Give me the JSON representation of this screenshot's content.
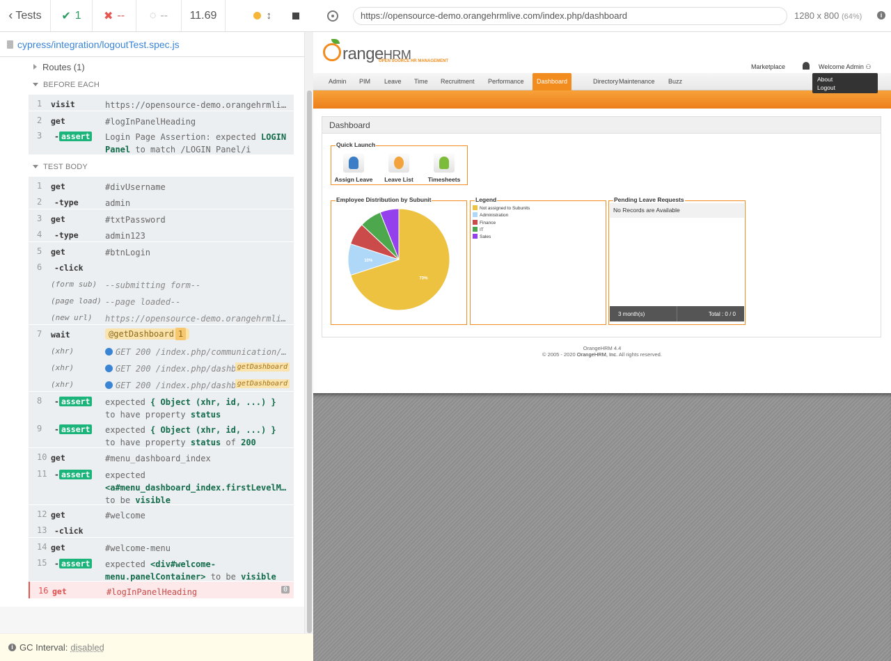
{
  "reporter": {
    "tests_label": "Tests",
    "passed": "1",
    "failed": "--",
    "pending": "--",
    "duration": "11.69",
    "spec_path": "cypress/integration/logoutTest.spec.js",
    "routes_label": "Routes (1)",
    "before_each_label": "BEFORE EACH",
    "test_body_label": "TEST BODY",
    "before_each": [
      {
        "num": "1",
        "name": "visit",
        "msg": "https://opensource-demo.orangehrmlive.com/"
      },
      {
        "num": "2",
        "name": "get",
        "msg": "#logInPanelHeading"
      },
      {
        "num": "3",
        "name": "assert",
        "msg_parts": [
          "Login Page Assertion: expected",
          "LOGIN Panel",
          "to match",
          "/LOGIN Panel/i"
        ]
      }
    ],
    "body": [
      {
        "num": "1",
        "name": "get",
        "msg": "#divUsername"
      },
      {
        "num": "2",
        "name": "-type",
        "msg": "admin"
      },
      {
        "num": "3",
        "name": "get",
        "msg": "#txtPassword"
      },
      {
        "num": "4",
        "name": "-type",
        "msg": "admin123"
      },
      {
        "num": "5",
        "name": "get",
        "msg": "#btnLogin"
      },
      {
        "num": "6",
        "name": "-click",
        "msg": ""
      },
      {
        "num": "",
        "name": "(form sub)",
        "msg": "--submitting form--"
      },
      {
        "num": "",
        "name": "(page load)",
        "msg": "--page loaded--"
      },
      {
        "num": "",
        "name": "(new url)",
        "msg": "https://opensource-demo.orangehrmlive.com/index.php/dashboard"
      },
      {
        "num": "7",
        "name": "wait",
        "alias": "@getDashboard",
        "alias_count": "1"
      },
      {
        "num": "",
        "name": "(xhr)",
        "msg": "GET 200 /index.php/communication/..."
      },
      {
        "num": "",
        "name": "(xhr)",
        "msg": "GET 200 /index.php/dashboard/...",
        "alias": "getDashboard"
      },
      {
        "num": "",
        "name": "(xhr)",
        "msg": "GET 200 /index.php/dashboard/...",
        "alias": "getDashboard"
      },
      {
        "num": "8",
        "name": "assert",
        "l1a": "expected",
        "l1b": "{ Object (xhr, id, ...) }",
        "l2a": "to have property",
        "l2b": "status"
      },
      {
        "num": "9",
        "name": "assert",
        "l1a": "expected",
        "l1b": "{ Object (xhr, id, ...) }",
        "l2a": "to have property",
        "l2b": "status",
        "l2c": "of",
        "l2d": "200"
      },
      {
        "num": "10",
        "name": "get",
        "msg": "#menu_dashboard_index"
      },
      {
        "num": "11",
        "name": "assert",
        "l1a": "expected",
        "l2b": "<a#menu_dashboard_index.firstLevelMenu>",
        "l3a": "to be",
        "l3b": "visible"
      },
      {
        "num": "12",
        "name": "get",
        "msg": "#welcome"
      },
      {
        "num": "13",
        "name": "-click",
        "msg": ""
      },
      {
        "num": "14",
        "name": "get",
        "msg": "#welcome-menu"
      },
      {
        "num": "15",
        "name": "assert",
        "l1a": "expected",
        "l1b": "<div#welcome-",
        "l2b": "menu.panelContainer>",
        "l2c": "to be",
        "l2d": "visible"
      },
      {
        "num": "16",
        "name": "get",
        "msg": "#logInPanelHeading",
        "retries": "0"
      }
    ],
    "gc_label": "GC Interval:",
    "gc_value": "disabled"
  },
  "aut": {
    "url": "https://opensource-demo.orangehrmlive.com/index.php/dashboard",
    "viewport": "1280 x 800",
    "scale": "(64%)",
    "brand_o": "O",
    "brand_rest": "range",
    "brand_hrm": "HRM",
    "tagline": "OPEN SOURCE HR MANAGEMENT",
    "marketplace": "Marketplace",
    "welcome": "Welcome Admin",
    "menu_items": [
      "About",
      "Logout"
    ],
    "nav": [
      "Admin",
      "PIM",
      "Leave",
      "Time",
      "Recruitment",
      "Performance",
      "Dashboard",
      "Directory",
      "Maintenance",
      "Buzz"
    ],
    "nav_active": "Dashboard",
    "dashboard_title": "Dashboard",
    "quick_launch_title": "Quick Launch",
    "quick_launch": [
      "Assign Leave",
      "Leave List",
      "Timesheets"
    ],
    "emp_dist_title": "Employee Distribution by Subunit",
    "legend_title": "Legend",
    "pending_title": "Pending Leave Requests",
    "pending_empty": "No Records are Available",
    "pending_period": "3 month(s)",
    "pending_total": "Total : 0 / 0",
    "footer_line1": "OrangeHRM 4.4",
    "footer_line2a": "© 2005 - 2020",
    "footer_link": "OrangeHRM, Inc.",
    "footer_line2b": "All rights reserved."
  },
  "chart_data": {
    "type": "pie",
    "title": "Employee Distribution by Subunit",
    "categories": [
      "Not assigned to Subunits",
      "Administration",
      "Finance",
      "IT",
      "Sales"
    ],
    "values": [
      70,
      10,
      7,
      7,
      6
    ],
    "colors": [
      "#edc240",
      "#afd8f8",
      "#cb4b4b",
      "#4da74d",
      "#9440ed"
    ],
    "data_labels": [
      "70%",
      "10%",
      "",
      "",
      ""
    ],
    "legend_position": "separate panel"
  }
}
